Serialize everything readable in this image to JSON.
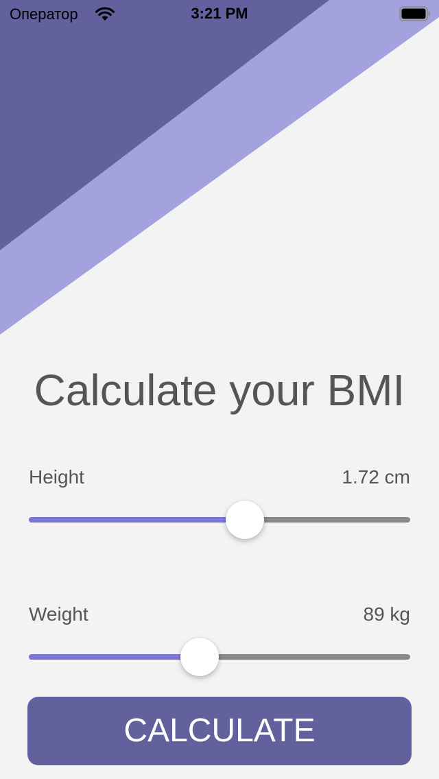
{
  "status_bar": {
    "carrier": "Оператор",
    "time": "3:21 PM",
    "wifi_icon": "wifi-icon",
    "battery_icon": "battery-icon"
  },
  "theme": {
    "background": "#F3F3F3",
    "dark_band": "#62609D",
    "light_band": "#A3A2DE",
    "text": "#555555",
    "slider_fill": "#7A77D9",
    "slider_track": "#888888",
    "button_background": "#62609D",
    "button_text": "#FFFFFF"
  },
  "main": {
    "title": "Calculate your BMI",
    "height": {
      "label": "Height",
      "value_text": "1.72 cm",
      "slider_fraction": 0.566
    },
    "weight": {
      "label": "Weight",
      "value_text": "89 kg",
      "slider_fraction": 0.447
    },
    "calculate_label": "CALCULATE"
  }
}
